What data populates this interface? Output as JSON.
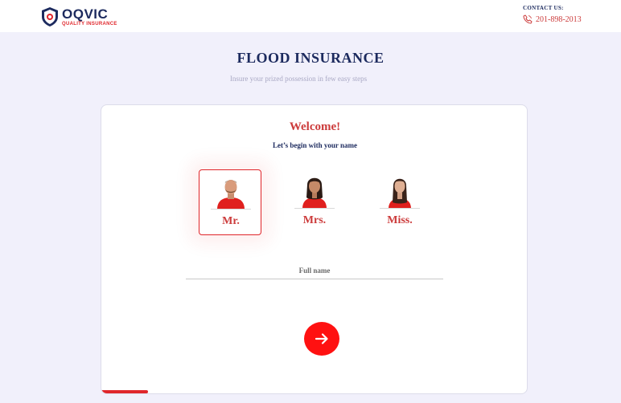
{
  "header": {
    "brand_name": "OQVIC",
    "brand_tagline": "QUALITY INSURANCE",
    "contact_label": "CONTACT US:",
    "contact_phone": "201-898-2013"
  },
  "page": {
    "title": "FLOOD INSURANCE",
    "subtitle": "Insure your prized possession in few easy steps"
  },
  "form": {
    "welcome": "Welcome!",
    "instruction": "Let’s begin with your name",
    "salutations": [
      {
        "label": "Mr.",
        "selected": true
      },
      {
        "label": "Mrs.",
        "selected": false
      },
      {
        "label": "Miss.",
        "selected": false
      }
    ],
    "full_name_placeholder": "Full name",
    "full_name_value": "",
    "next_icon": "arrow-right-icon",
    "progress_fraction": 0.11
  },
  "colors": {
    "brand_navy": "#1c2a5e",
    "brand_red": "#e0262b",
    "accent_red": "#cc3b3b",
    "button_red": "#ff1111",
    "background": "#f1f0fb"
  }
}
